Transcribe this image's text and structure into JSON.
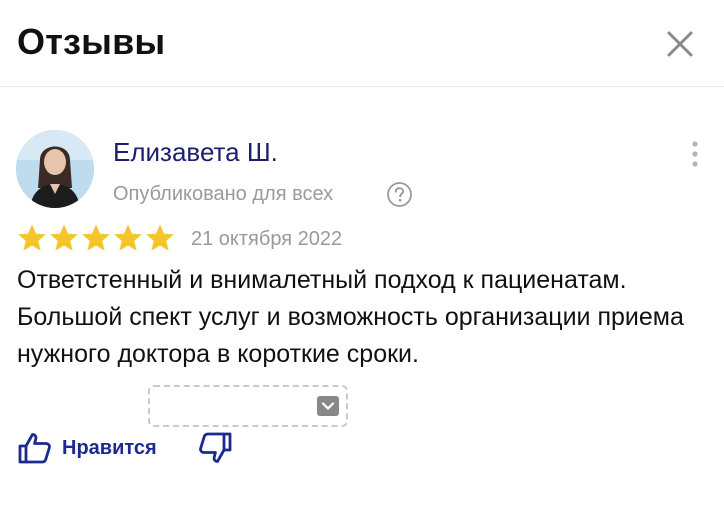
{
  "header": {
    "title": "Отзывы",
    "close_icon": "close-icon"
  },
  "review": {
    "author": "Елизавета Ш.",
    "visibility": "Опубликовано для всех",
    "help_icon": "question-icon",
    "more_icon": "more-vertical-icon",
    "rating": 5,
    "rating_max": 5,
    "star_color": "#f5c52a",
    "date": "21 октября 2022",
    "text": "Ответстенный и внималетный подход к пациенатам. Большой спект услуг и возможность организации приема нужного доктора в короткие сроки.",
    "expand_icon": "chevron-down-icon"
  },
  "actions": {
    "like_label": "Нравится",
    "like_icon": "thumbs-up-icon",
    "dislike_icon": "thumbs-down-icon",
    "accent": "#1b2a8f"
  }
}
